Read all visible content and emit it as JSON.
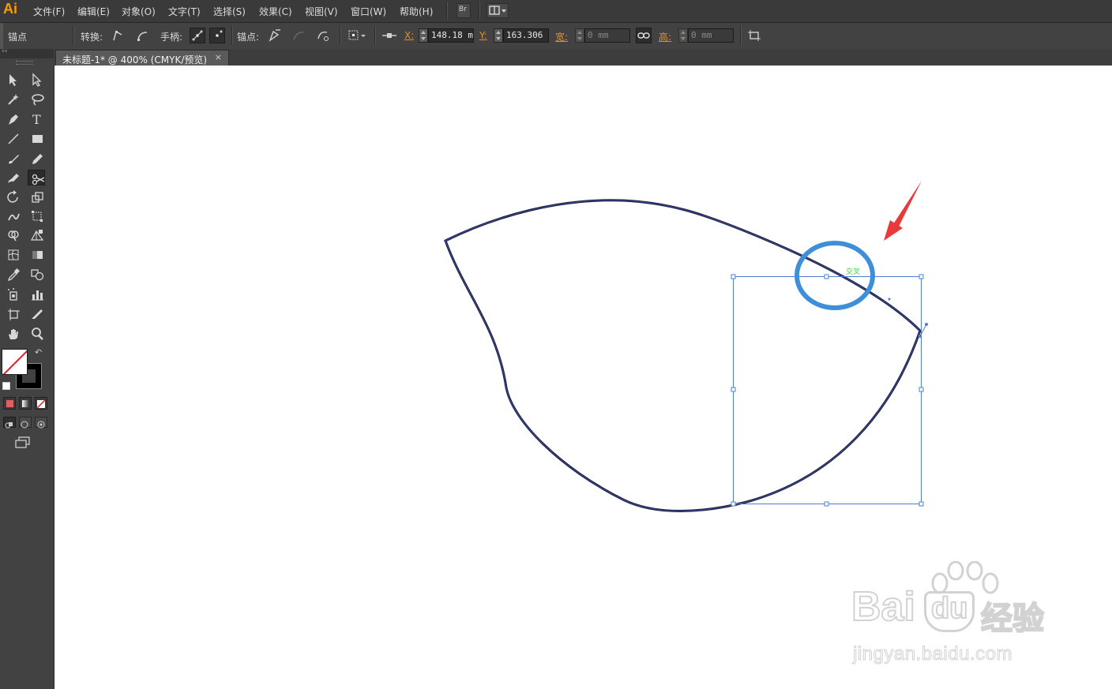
{
  "app": {
    "logo": "Ai"
  },
  "menu": {
    "items": [
      "文件(F)",
      "编辑(E)",
      "对象(O)",
      "文字(T)",
      "选择(S)",
      "效果(C)",
      "视图(V)",
      "窗口(W)",
      "帮助(H)"
    ],
    "bridge_label": "Br"
  },
  "control": {
    "anchor_title": "锚点",
    "convert_label": "转换:",
    "handles_label": "手柄:",
    "anchors_label": "锚点:",
    "x_label": "X:",
    "x_value": "148.18 mm",
    "y_label": "Y:",
    "y_value": "163.306 mm",
    "width_label": "宽:",
    "width_value": "0 mm",
    "height_label": "高:",
    "height_value": "0 mm"
  },
  "document": {
    "tab_title": "未标题-1* @ 400% (CMYK/预览)",
    "tab_close": "×"
  },
  "canvas": {
    "smart_guide_label": "交叉",
    "watermark_brand": "Bai",
    "watermark_du": "du",
    "watermark_cn": "经验",
    "watermark_url": "jingyan.baidu.com"
  },
  "colors": {
    "accent_orange": "#ff9a00",
    "path_stroke": "#1c1c3a",
    "selection_blue": "#4a7fd0",
    "highlight_circle": "#3f8fd8",
    "arrow_red": "#e83a3a",
    "smart_guide_green": "#3ecf3e"
  },
  "tools": [
    "selection-tool",
    "direct-selection-tool",
    "magic-wand-tool",
    "lasso-tool",
    "pen-tool",
    "type-tool",
    "line-segment-tool",
    "rectangle-tool",
    "paintbrush-tool",
    "pencil-tool",
    "blob-brush-tool",
    "scissors-tool",
    "rotate-tool",
    "scale-tool",
    "warp-tool",
    "free-transform-tool",
    "shape-builder-tool",
    "perspective-grid-tool",
    "mesh-tool",
    "gradient-tool",
    "eyedropper-tool",
    "blend-tool",
    "symbol-sprayer-tool",
    "column-graph-tool",
    "artboard-tool",
    "slice-tool",
    "hand-tool",
    "zoom-tool"
  ]
}
